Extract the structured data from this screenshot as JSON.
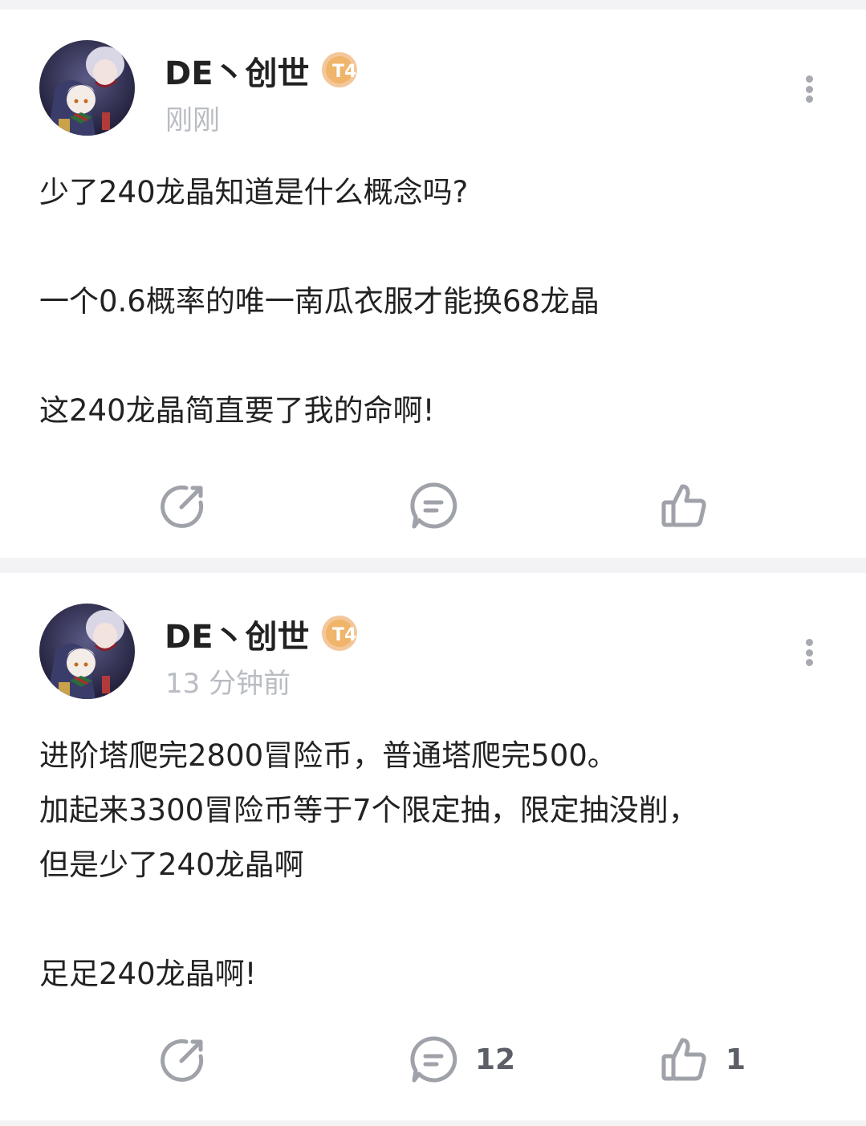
{
  "posts": [
    {
      "username": "DE丶创世",
      "badge_icon": "level-badge-icon",
      "badge_text": "T4",
      "timestamp": "刚刚",
      "content_lines": [
        "少了240龙晶知道是什么概念吗?",
        "",
        "一个0.6概率的唯一南瓜衣服才能换68龙晶",
        "",
        "这240龙晶简直要了我的命啊!"
      ],
      "actions": {
        "share_icon": "share-icon",
        "comment_icon": "comment-icon",
        "comment_count": "",
        "like_icon": "thumbs-up-icon",
        "like_count": ""
      }
    },
    {
      "username": "DE丶创世",
      "badge_icon": "level-badge-icon",
      "badge_text": "T4",
      "timestamp": "13 分钟前",
      "content_lines": [
        "进阶塔爬完2800冒险币，普通塔爬完500。",
        "加起来3300冒险币等于7个限定抽，限定抽没削，",
        "但是少了240龙晶啊",
        "",
        "足足240龙晶啊!"
      ],
      "actions": {
        "share_icon": "share-icon",
        "comment_icon": "comment-icon",
        "comment_count": "12",
        "like_icon": "thumbs-up-icon",
        "like_count": "1"
      }
    }
  ],
  "colors": {
    "page_background": "#f3f3f5",
    "card_background": "#ffffff",
    "text_primary": "#222222",
    "text_secondary": "#b9bcc2",
    "icon_gray": "#9fa2a8",
    "badge_gold": "#f0b46a"
  }
}
